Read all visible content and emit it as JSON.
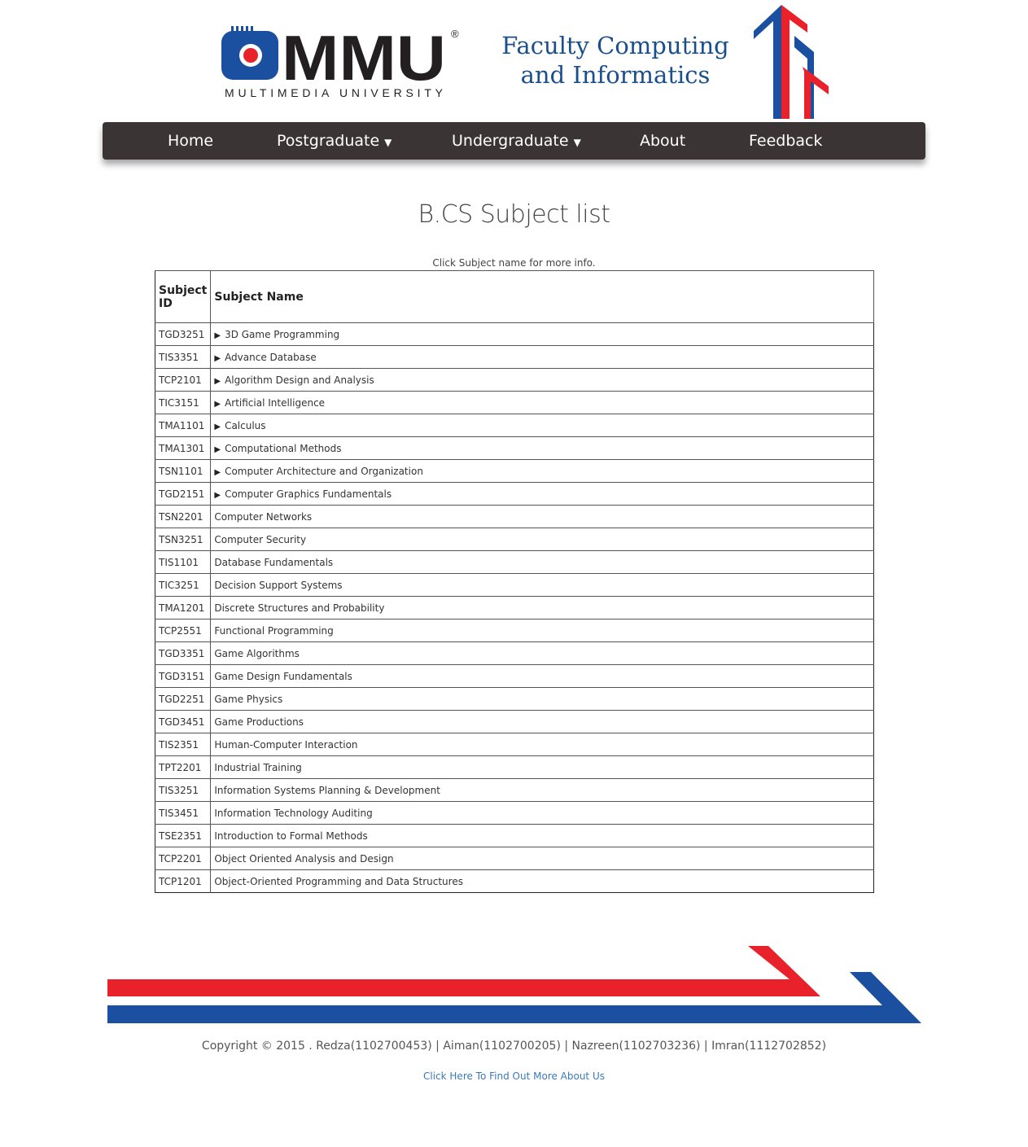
{
  "header": {
    "logo_text": "MMU",
    "logo_subtext": "MULTIMEDIA UNIVERSITY",
    "logo_registered": "®",
    "faculty_line1": "Faculty Computing",
    "faculty_line2": "and Informatics"
  },
  "nav": {
    "home": "Home",
    "postgraduate": "Postgraduate",
    "undergraduate": "Undergraduate",
    "about": "About",
    "feedback": "Feedback",
    "caret": "▼"
  },
  "main": {
    "title": "B.CS Subject list",
    "hint": "Click Subject name for more info."
  },
  "table": {
    "headers": [
      "Subject ID",
      "Subject Name"
    ],
    "rows": [
      {
        "id": "TGD3251",
        "name": "3D Game Programming",
        "expandable": true
      },
      {
        "id": "TIS3351",
        "name": "Advance Database",
        "expandable": true
      },
      {
        "id": "TCP2101",
        "name": "Algorithm Design and Analysis",
        "expandable": true
      },
      {
        "id": "TIC3151",
        "name": "Artificial Intelligence",
        "expandable": true
      },
      {
        "id": "TMA1101",
        "name": "Calculus",
        "expandable": true
      },
      {
        "id": "TMA1301",
        "name": "Computational Methods",
        "expandable": true
      },
      {
        "id": "TSN1101",
        "name": "Computer Architecture and Organization",
        "expandable": true
      },
      {
        "id": "TGD2151",
        "name": "Computer Graphics Fundamentals",
        "expandable": true
      },
      {
        "id": "TSN2201",
        "name": "Computer Networks",
        "expandable": false
      },
      {
        "id": "TSN3251",
        "name": "Computer Security",
        "expandable": false
      },
      {
        "id": "TIS1101",
        "name": "Database Fundamentals",
        "expandable": false
      },
      {
        "id": "TIC3251",
        "name": "Decision Support Systems",
        "expandable": false
      },
      {
        "id": "TMA1201",
        "name": "Discrete Structures and Probability",
        "expandable": false
      },
      {
        "id": "TCP2551",
        "name": "Functional Programming",
        "expandable": false
      },
      {
        "id": "TGD3351",
        "name": "Game Algorithms",
        "expandable": false
      },
      {
        "id": "TGD3151",
        "name": "Game Design Fundamentals",
        "expandable": false
      },
      {
        "id": "TGD2251",
        "name": "Game Physics",
        "expandable": false
      },
      {
        "id": "TGD3451",
        "name": "Game Productions",
        "expandable": false
      },
      {
        "id": "TIS2351",
        "name": "Human-Computer Interaction",
        "expandable": false
      },
      {
        "id": "TPT2201",
        "name": "Industrial Training",
        "expandable": false
      },
      {
        "id": "TIS3251",
        "name": "Information Systems Planning & Development",
        "expandable": false
      },
      {
        "id": "TIS3451",
        "name": "Information Technology Auditing",
        "expandable": false
      },
      {
        "id": "TSE2351",
        "name": "Introduction to Formal Methods",
        "expandable": false
      },
      {
        "id": "TCP2201",
        "name": "Object Oriented Analysis and Design",
        "expandable": false
      },
      {
        "id": "TCP1201",
        "name": "Object-Oriented Programming and Data Structures",
        "expandable": false
      }
    ]
  },
  "footer": {
    "copyright": "Copyright © 2015 . Redza(1102700453) | Aiman(1102700205) | Nazreen(1102703236) | Imran(1112702852)",
    "more_link": "Click Here To Find Out More About Us"
  },
  "colors": {
    "nav_bg": "#3a3434",
    "brand_red": "#e8212b",
    "brand_blue": "#1b4fa0",
    "faculty_text": "#1b4f8c",
    "link": "#3b7ab8"
  }
}
